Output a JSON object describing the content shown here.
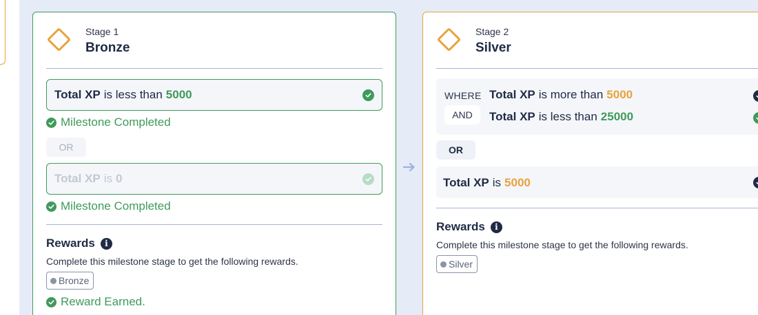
{
  "stages": [
    {
      "number_label": "Stage 1",
      "name": "Bronze",
      "condition1": {
        "field": "Total XP",
        "op": "is less than",
        "value": "5000"
      },
      "condition1_status": "Milestone Completed",
      "or_label": "OR",
      "condition2": {
        "field": "Total XP",
        "op": "is",
        "value": "0"
      },
      "condition2_status": "Milestone Completed",
      "rewards_title": "Rewards",
      "rewards_desc": "Complete this milestone stage to get the following rewards.",
      "reward_tag": "Bronze",
      "reward_status": "Reward Earned."
    },
    {
      "number_label": "Stage 2",
      "name": "Silver",
      "where_label": "WHERE",
      "condition1": {
        "field": "Total XP",
        "op": "is more than",
        "value": "5000"
      },
      "and_label": "AND",
      "condition2": {
        "field": "Total XP",
        "op": "is less than",
        "value": "25000"
      },
      "or_label": "OR",
      "condition3": {
        "field": "Total XP",
        "op": "is",
        "value": "5000"
      },
      "rewards_title": "Rewards",
      "rewards_desc": "Complete this milestone stage to get the following rewards.",
      "reward_tag": "Silver"
    }
  ],
  "colors": {
    "completed": "#3f9a5b",
    "in_progress": "#e8a33c",
    "track_background": "#e6ebf8",
    "text_dark": "#1f2a44"
  },
  "icons": {
    "stage": "diamond-icon",
    "check": "check-circle-icon",
    "info": "info-icon",
    "connector": "arrow-right-icon"
  }
}
